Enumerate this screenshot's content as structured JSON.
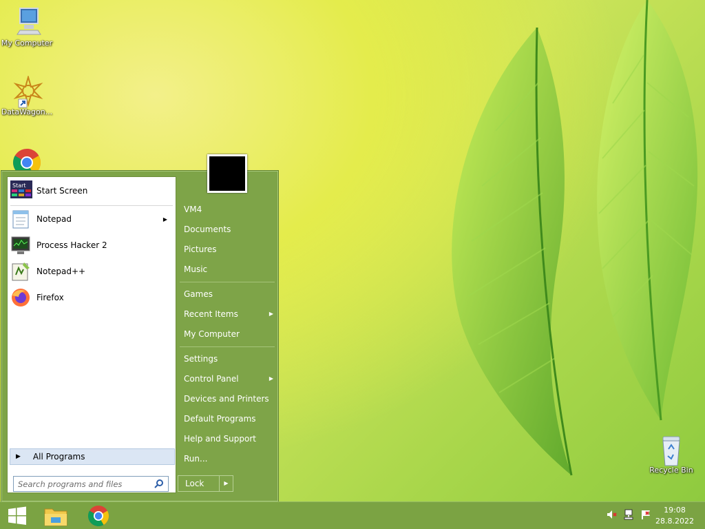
{
  "desktop": {
    "icons": [
      {
        "label": "My Computer",
        "icon": "my-computer-icon"
      },
      {
        "label": "DataWagon...",
        "icon": "datawagon-icon"
      },
      {
        "label": "Google Chrome",
        "icon": "chrome-icon"
      },
      {
        "label": "Recycle Bin",
        "icon": "recycle-bin-icon"
      }
    ]
  },
  "start_menu": {
    "pinned": [
      {
        "label": "Start Screen",
        "icon": "start-screen-icon",
        "submenu": false
      },
      {
        "label": "Notepad",
        "icon": "notepad-icon",
        "submenu": true
      },
      {
        "label": "Process Hacker 2",
        "icon": "process-hacker-icon",
        "submenu": false
      },
      {
        "label": "Notepad++",
        "icon": "notepad-plus-plus-icon",
        "submenu": false
      },
      {
        "label": "Firefox",
        "icon": "firefox-icon",
        "submenu": false
      }
    ],
    "start_screen_icon_text": "Start",
    "all_programs_label": "All Programs",
    "search_placeholder": "Search programs and files",
    "right_items": [
      {
        "label": "VM4",
        "submenu": false
      },
      {
        "label": "Documents",
        "submenu": false
      },
      {
        "label": "Pictures",
        "submenu": false
      },
      {
        "label": "Music",
        "submenu": false
      },
      {
        "label": "Games",
        "submenu": false
      },
      {
        "label": "Recent Items",
        "submenu": true
      },
      {
        "label": "My Computer",
        "submenu": false
      },
      {
        "label": "Settings",
        "submenu": false
      },
      {
        "label": "Control Panel",
        "submenu": true
      },
      {
        "label": "Devices and Printers",
        "submenu": false
      },
      {
        "label": "Default Programs",
        "submenu": false
      },
      {
        "label": "Help and Support",
        "submenu": false
      },
      {
        "label": "Run...",
        "submenu": false
      }
    ],
    "lock_label": "Lock"
  },
  "taskbar": {
    "apps": [
      {
        "icon": "windows-start-icon"
      },
      {
        "icon": "file-explorer-icon"
      },
      {
        "icon": "chrome-icon"
      }
    ],
    "tray": [
      {
        "icon": "volume-muted-icon"
      },
      {
        "icon": "network-icon"
      },
      {
        "icon": "action-center-flag-icon"
      }
    ],
    "time": "19:08",
    "date": "28.8.2022"
  },
  "colors": {
    "accent": "#7ea448",
    "taskbar": "#7ba343",
    "all_programs_highlight": "#dbe6f4"
  }
}
